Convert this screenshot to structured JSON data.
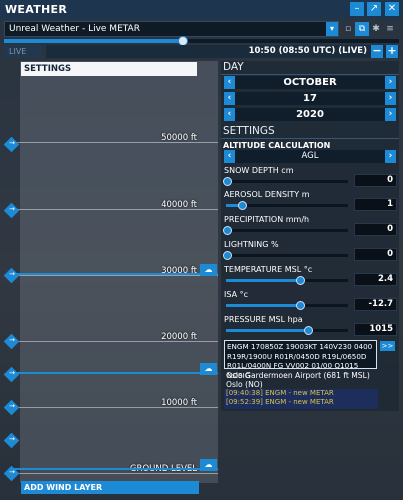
{
  "window": {
    "title": "WEATHER"
  },
  "titlebar_buttons": [
    "–",
    "↗",
    "✕",
    "✕"
  ],
  "preset": {
    "name": "Unreal Weather - Live METAR"
  },
  "time": {
    "live_label": "LIVE",
    "display": "10:50 (08:50 UTC) (LIVE)",
    "slider_fraction": 0.45
  },
  "altitude": {
    "settings_label": "SETTINGS",
    "labels": [
      "50000 ft",
      "40000 ft",
      "30000 ft",
      "20000 ft",
      "10000 ft",
      "GROUND LEVEL"
    ],
    "add_wind_layer": "ADD WIND LAYER"
  },
  "day": {
    "header": "DAY",
    "month": "OCTOBER",
    "date": "17",
    "year": "2020"
  },
  "settings": {
    "header": "SETTINGS",
    "altitude_calc_label": "ALTITUDE CALCULATION",
    "altitude_calc_value": "AGL",
    "params": [
      {
        "label": "SNOW DEPTH cm",
        "value": "0",
        "fraction": 0.0
      },
      {
        "label": "AEROSOL DENSITY m",
        "value": "1",
        "fraction": 0.12
      },
      {
        "label": "PRECIPITATION mm/h",
        "value": "0",
        "fraction": 0.0
      },
      {
        "label": "LIGHTNING %",
        "value": "0",
        "fraction": 0.0
      },
      {
        "label": "TEMPERATURE MSL °c",
        "value": "2.4",
        "fraction": 0.6
      },
      {
        "label": "ISA °c",
        "value": "-12.7",
        "fraction": 0.6
      },
      {
        "label": "PRESSURE MSL hpa",
        "value": "1015",
        "fraction": 0.66
      }
    ]
  },
  "metar": {
    "lines": [
      "ENGM 170850Z 19003KT 140V230 0400",
      "R19R/1900U R01R/0450D R19L/0650D",
      "R01L/0400N FG VV002 01/00 Q1015 NOSIG"
    ],
    "forward_label": ">>"
  },
  "station": {
    "name": "Oslo Gardermoen Airport (681 ft MSL)",
    "city": "Oslo (NO)"
  },
  "log": [
    "[09:40:38] ENGM - new METAR",
    "[09:52:39] ENGM - new METAR"
  ],
  "colors": {
    "accent": "#1d8ad6",
    "titlebar": "#1e3550",
    "log_text": "#d6c24c"
  },
  "icons": [
    "wind-direction-icon",
    "cloud-icon",
    "chevron-left-icon",
    "chevron-right-icon"
  ]
}
